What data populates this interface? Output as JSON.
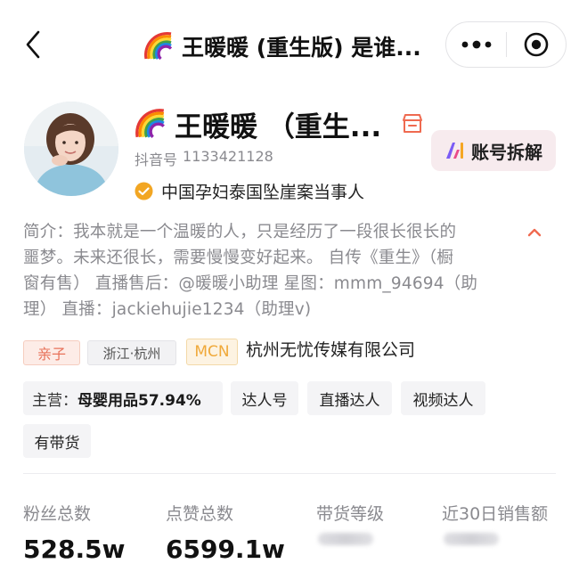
{
  "nav": {
    "title": "王暖暖 (重生版) 是谁...",
    "title_icon": "rainbow-emoji",
    "back_icon": "chevron-left-icon",
    "more_icon": "more-dots-icon",
    "close_icon": "target-close-icon"
  },
  "profile": {
    "name": "王暖暖 （重生...",
    "douyin_label": "抖音号",
    "douyin_id": "1133421128",
    "verification": "中国孕妇泰国坠崖案当事人",
    "analyze_button": "账号拆解"
  },
  "bio": {
    "lines": [
      "简介：我本就是一个温暖的人，只是经历了一段很长很长的",
      "噩梦。未来还很长，需要慢慢变好起来。 自传《重生》（橱",
      "窗有售） 直播售后：@暖暖小助理 星图：mmm_94694（助",
      "理） 直播：jackiehujie1234（助理v)"
    ]
  },
  "tags": {
    "category": "亲子",
    "region": "浙江·杭州",
    "mcn_label": "MCN",
    "mcn_company": "杭州无忧传媒有限公司"
  },
  "chips": {
    "main_label": "主营：",
    "main_value": "母婴用品57.94%",
    "talent": "达人号",
    "live": "直播达人",
    "video": "视频达人",
    "goods": "有带货"
  },
  "stats": {
    "fans_label": "粉丝总数",
    "fans_value": "528.5w",
    "likes_label": "点赞总数",
    "likes_value": "6599.1w",
    "level_label": "带货等级",
    "sales_label": "近30日销售额"
  },
  "colors": {
    "tag_parent": "#e8725a",
    "tag_mcn": "#f0a93a",
    "verify_badge": "#f2a623",
    "shop_icon": "#ef6a50",
    "analyze_bg": "#f7ebee"
  }
}
